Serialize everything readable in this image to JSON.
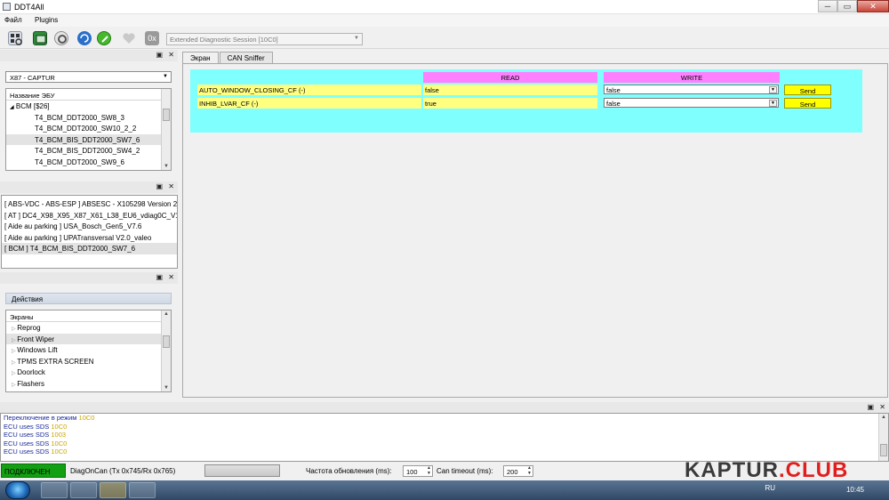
{
  "window": {
    "title": "DDT4All",
    "controls": {
      "minimize": "─",
      "maximize": "▭",
      "close": "✕"
    }
  },
  "menu": {
    "items": [
      "Файл",
      "Plugins"
    ]
  },
  "toolbar": {
    "icons": [
      "scan-icon",
      "ecu-icon",
      "gear-icon",
      "refresh-icon",
      "connect-icon",
      "heartbeat-icon",
      "hex-icon"
    ],
    "hex_label": "0x",
    "session": "Extended Diagnostic Session [10C0]"
  },
  "vehicle": {
    "selected": "X87 - CAPTUR"
  },
  "ecu_tree": {
    "header": "Название ЭБУ",
    "root": "BCM [$26]",
    "items": [
      "T4_BCM_DDT2000_SW8_3",
      "T4_BCM_DDT2000_SW10_2_2",
      "T4_BCM_BIS_DDT2000_SW7_6",
      "T4_BCM_BIS_DDT2000_SW4_2",
      "T4_BCM_DDT2000_SW9_6"
    ],
    "selected_index": 2
  },
  "ecu_list": {
    "items": [
      "[ ABS-VDC - ABS-ESP ] ABSESC - X105298 Version 2",
      "[ AT ] DC4_X98_X95_X87_X61_L38_EU6_vdiag0C_V1.",
      "[ Aide au parking ] USA_Bosch_Gen5_V7.6",
      "[ Aide au parking ] UPATransversal V2.0_valeo",
      "[ BCM ] T4_BCM_BIS_DDT2000_SW7_6"
    ],
    "selected_index": 4
  },
  "actions": {
    "title": "Действия",
    "screens_header": "Экраны",
    "items": [
      "Reprog",
      "Front Wiper",
      "Windows Lift",
      "TPMS EXTRA SCREEN",
      "Doorlock",
      "Flashers"
    ],
    "selected_index": 1
  },
  "tabs": [
    "Экран",
    "CAN Sniffer"
  ],
  "screen": {
    "read_header": "READ",
    "write_header": "WRITE",
    "colors": {
      "panel": "#80ffff",
      "header": "#ff80ff",
      "field": "#ffff80",
      "button": "#ffff00"
    },
    "params": [
      {
        "name": "AUTO_WINDOW_CLOSING_CF (-)",
        "read": "false",
        "write": "false",
        "send": "Send"
      },
      {
        "name": "INHIB_LVAR_CF (-)",
        "read": "true",
        "write": "false",
        "send": "Send"
      }
    ]
  },
  "log": {
    "lines": [
      {
        "text": "Переключение в режим ",
        "value": "10C0"
      },
      {
        "text": "ECU uses SDS ",
        "value": "10C0"
      },
      {
        "text": "ECU uses SDS ",
        "value": "1003"
      },
      {
        "text": "ECU uses SDS ",
        "value": "10C0"
      },
      {
        "text": "ECU uses SDS ",
        "value": "10C0"
      }
    ]
  },
  "status": {
    "connected": "ПОДКЛЮЧЕН",
    "protocol": "DiagOnCan (Tx 0x745/Rx 0x765)",
    "refresh_label": "Частота обновления (ms):",
    "refresh_value": "100",
    "timeout_label": "Can timeout (ms):",
    "timeout_value": "200"
  },
  "watermark": {
    "part1": "KAPTUR",
    "part2": ".CLUB"
  },
  "taskbar": {
    "lang": "RU",
    "time": "10:45"
  }
}
